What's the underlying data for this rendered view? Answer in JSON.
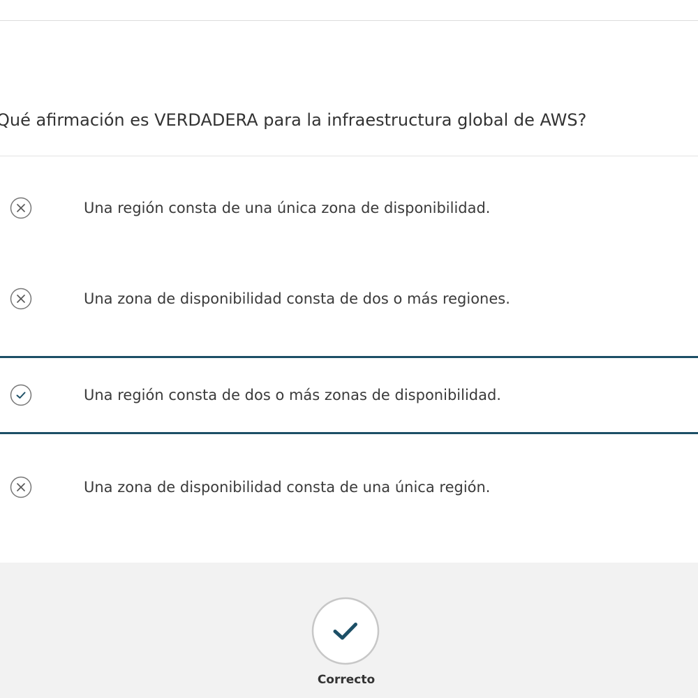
{
  "question": {
    "text": "Qué afirmación es VERDADERA para la infraestructura global de AWS?"
  },
  "options": [
    {
      "label": "Una región consta de una única zona de disponibilidad.",
      "icon": "x-circle-icon",
      "selected": false
    },
    {
      "label": "Una zona de disponibilidad consta de dos o más regiones.",
      "icon": "x-circle-icon",
      "selected": false
    },
    {
      "label": "Una región consta de dos o más zonas de disponibilidad.",
      "icon": "check-circle-icon",
      "selected": true
    },
    {
      "label": "Una zona de disponibilidad consta de una única región.",
      "icon": "x-circle-icon",
      "selected": false
    }
  ],
  "result": {
    "label": "Correcto",
    "icon": "check-circle-icon"
  },
  "colors": {
    "accent": "#1c4f66",
    "text": "#3a3a3a",
    "icon_gray": "#777777",
    "result_background": "#f2f2f2",
    "divider": "#dcdcdc"
  }
}
